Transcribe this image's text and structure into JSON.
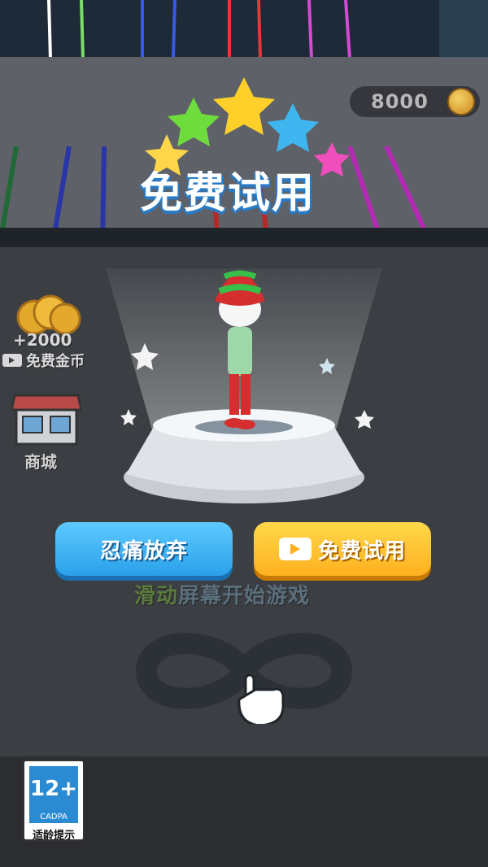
{
  "coins": {
    "amount": "8000"
  },
  "title": {
    "text": "免费试用"
  },
  "side": {
    "bonus_amount": "+2000",
    "bonus_label": "免费金币",
    "shop_label": "商城"
  },
  "buttons": {
    "give_up": "忍痛放弃",
    "free_trial": "免费试用"
  },
  "hint": {
    "part1": "滑动",
    "part2": "屏幕开始游戏"
  },
  "age": {
    "rating": "12+",
    "org": "CADPA",
    "label": "适龄提示"
  },
  "colors": {
    "blue_button": "#2aa1ea",
    "yellow_button": "#ffb01f",
    "rating_blue": "#2a8bd3"
  }
}
